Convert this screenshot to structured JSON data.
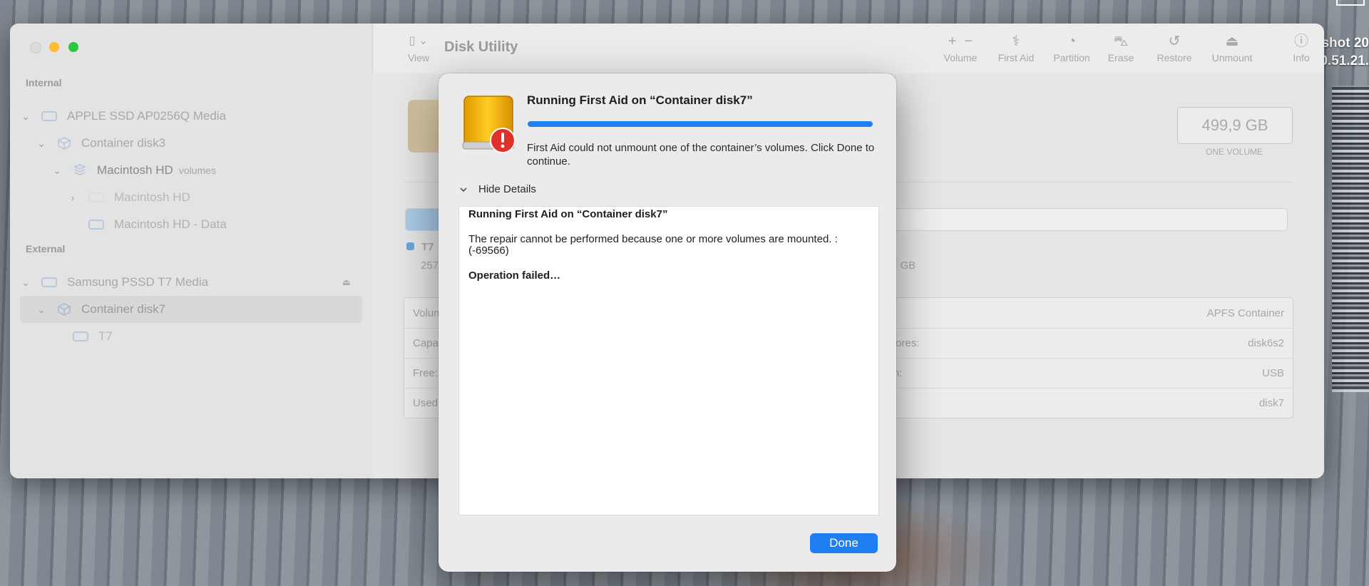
{
  "desktop": {
    "screenshot_label": "shot 20\n0.51.21."
  },
  "window": {
    "title": "Disk Utility",
    "sidebar": {
      "internal_header": "Internal",
      "external_header": "External",
      "items": [
        {
          "label": "APPLE SSD AP0256Q Media"
        },
        {
          "label": "Container disk3"
        },
        {
          "label": "Macintosh HD",
          "suffix": "volumes"
        },
        {
          "label": "Macintosh HD"
        },
        {
          "label": "Macintosh HD - Data"
        },
        {
          "label": "Samsung PSSD T7 Media"
        },
        {
          "label": "Container disk7"
        },
        {
          "label": "T7"
        }
      ]
    },
    "toolbar": {
      "view": "View",
      "volume": "Volume",
      "first_aid": "First Aid",
      "partition": "Partition",
      "erase": "Erase",
      "restore": "Restore",
      "unmount": "Unmount",
      "info": "Info"
    },
    "main": {
      "size": "499,9 GB",
      "size_sub": "ONE VOLUME",
      "legend_label": "T7",
      "legend_sub": "257",
      "right_value": "7 GB",
      "table_left": [
        "Volum",
        "Capa",
        "Free:",
        "Used"
      ],
      "table_mid": [
        "l stores:",
        "tion:"
      ],
      "table_right": [
        "APFS Container",
        "disk6s2",
        "USB",
        "disk7"
      ],
      "usage_fraction": 0.06
    }
  },
  "dialog": {
    "title": "Running First Aid on “Container disk7”",
    "progress": 1.0,
    "message": "First Aid could not unmount one of the container’s volumes. Click Done to continue.",
    "details_toggle": "Hide Details",
    "log": {
      "heading": "Running First Aid on “Container disk7”",
      "line1": "The repair cannot be performed because one or more volumes are mounted. :",
      "line2": "(-69566)",
      "result": "Operation failed…"
    },
    "done_button": "Done"
  },
  "colors": {
    "accent": "#1f7ff2",
    "warning": "#e0302a",
    "drive": "#f2b400"
  }
}
